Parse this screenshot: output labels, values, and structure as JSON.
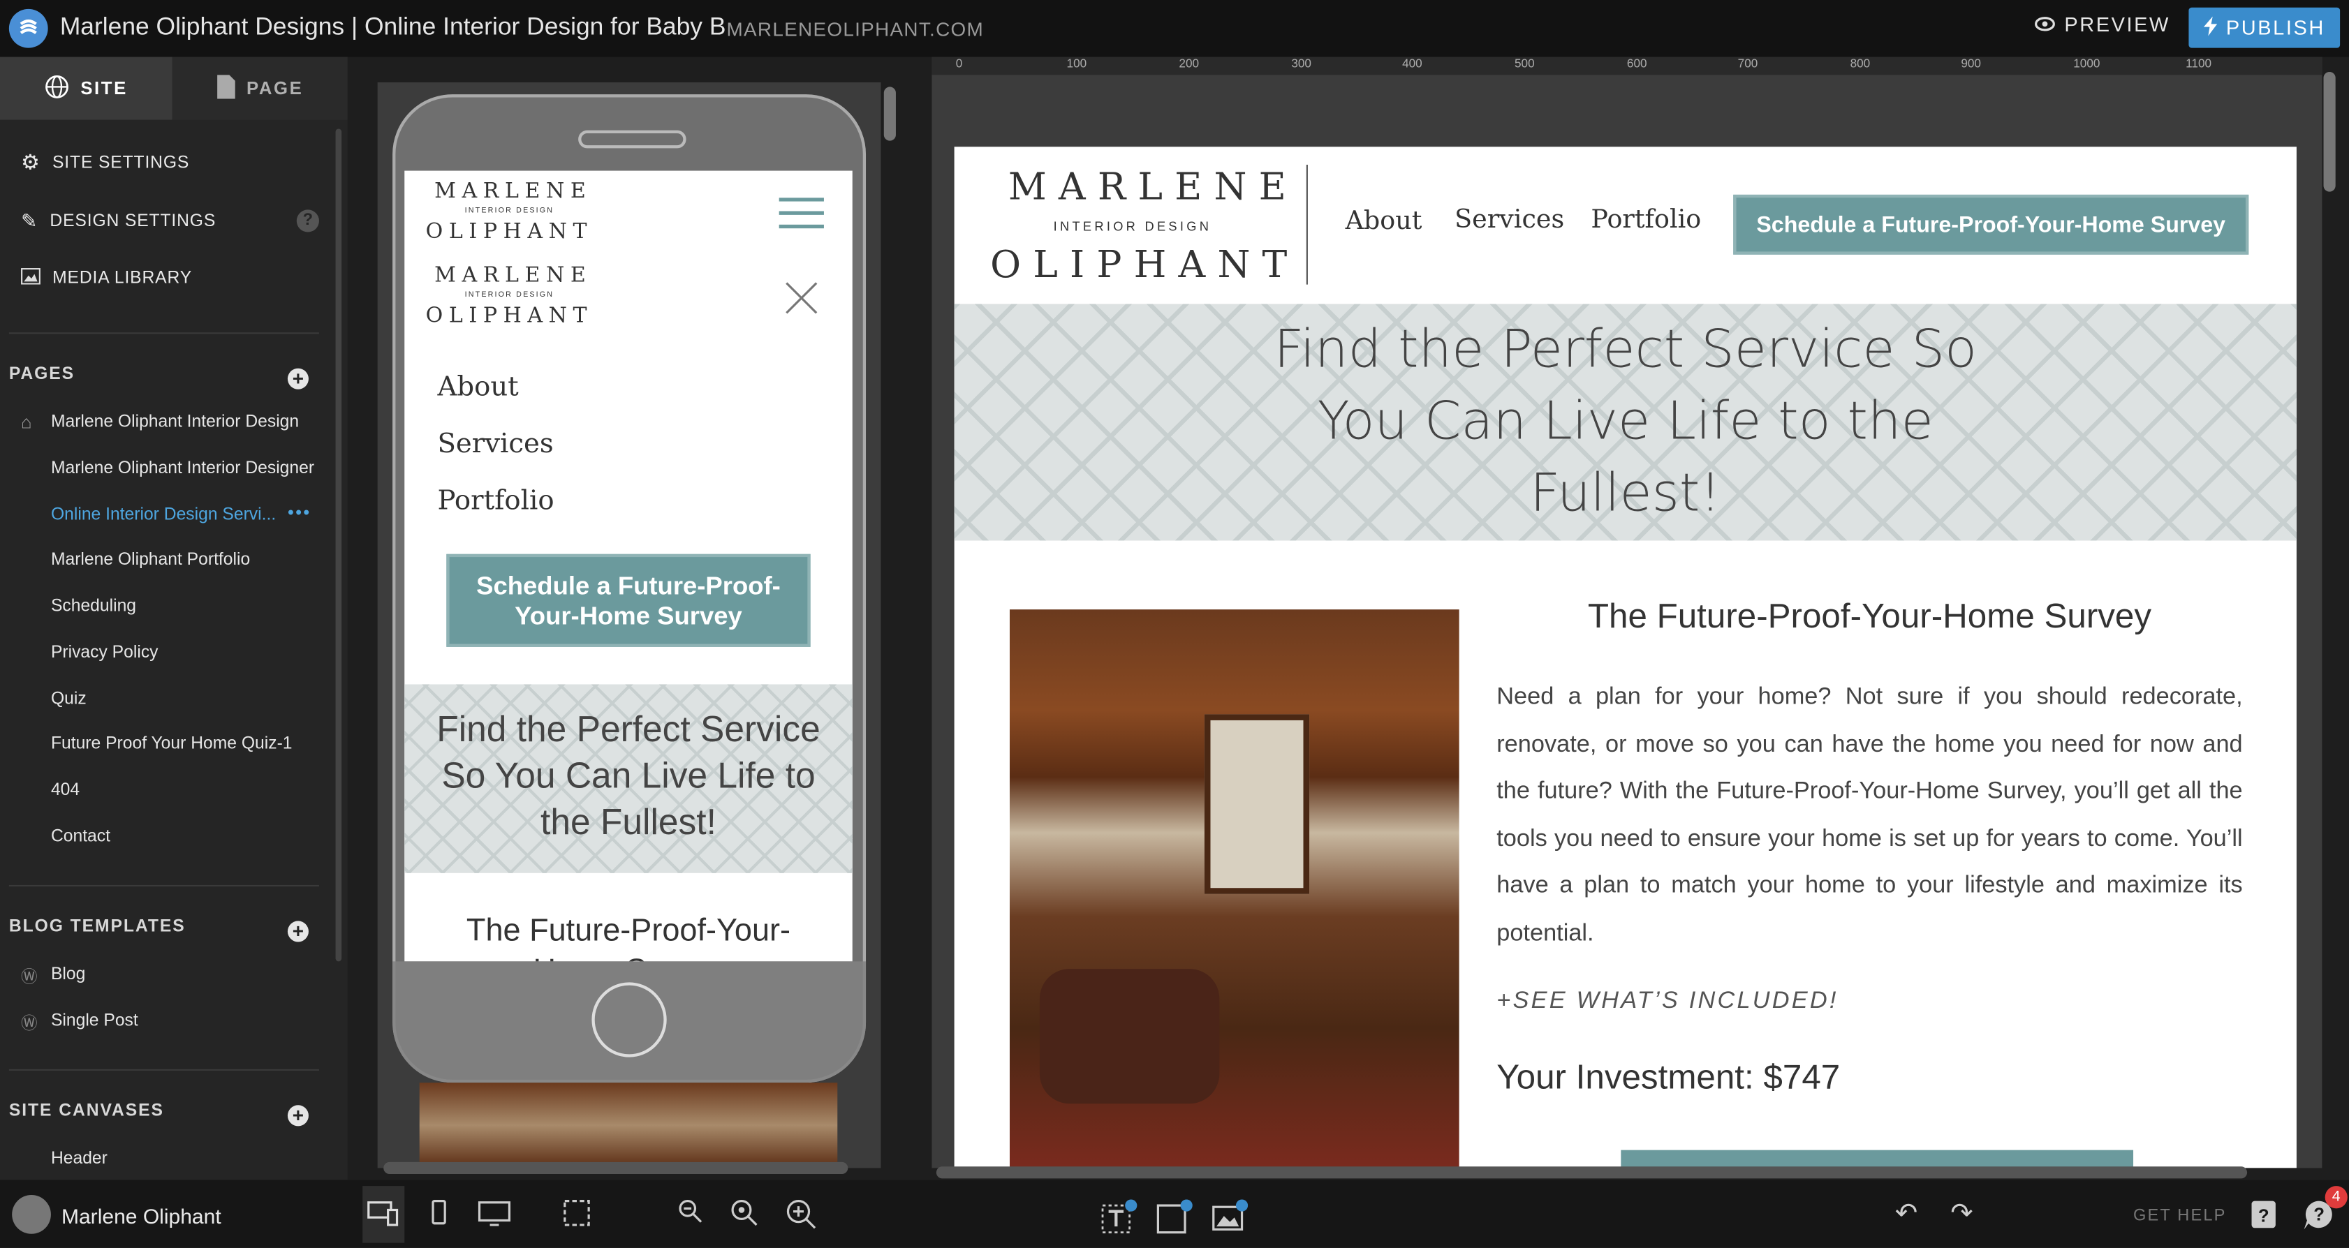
{
  "topbar": {
    "site_title": "Marlene Oliphant Designs | Online Interior Design for Baby B",
    "domain": "MARLENEOLIPHANT.COM",
    "preview_label": "PREVIEW",
    "publish_label": "PUBLISH"
  },
  "sidebar": {
    "site_tab": "SITE",
    "page_tab": "PAGE",
    "settings": [
      {
        "label": "SITE SETTINGS",
        "icon": "gear-icon"
      },
      {
        "label": "DESIGN SETTINGS",
        "icon": "brush-icon"
      },
      {
        "label": "MEDIA LIBRARY",
        "icon": "image-icon"
      }
    ],
    "pages_heading": "PAGES",
    "pages": [
      "Marlene Oliphant Interior Design",
      "Marlene Oliphant Interior Designer",
      "Online Interior Design Servi...",
      "Marlene Oliphant Portfolio",
      "Scheduling",
      "Privacy Policy",
      "Quiz",
      "Future Proof Your Home Quiz-1",
      "404",
      "Contact"
    ],
    "active_page_index": 2,
    "blog_heading": "BLOG TEMPLATES",
    "blog_templates": [
      "Blog",
      "Single Post"
    ],
    "canvases_heading": "SITE CANVASES",
    "canvases": [
      "Header"
    ]
  },
  "bottombar": {
    "user_name": "Marlene Oliphant",
    "help_label": "GET HELP",
    "notification_count": "4"
  },
  "ruler": {
    "ticks": [
      "0",
      "100",
      "200",
      "300",
      "400",
      "500",
      "600",
      "700",
      "800",
      "900",
      "1000",
      "1100"
    ]
  },
  "site": {
    "logo_line1": "MARLENE",
    "logo_sub": "INTERIOR DESIGN",
    "logo_line2": "OLIPHANT",
    "nav": [
      "About",
      "Services",
      "Portfolio"
    ],
    "cta": "Schedule a Future-Proof-Your-Home Survey",
    "banner_title": "Find the Perfect Service So You Can Live Life to the Fullest!",
    "survey_title": "The Future-Proof-Your-Home Survey",
    "body": "Need a plan for your home? Not sure if you should redecorate, renovate, or move so you can have the home you need for now and the future? With the Future-Proof-Your-Home Survey, you’ll get all the tools you need to ensure your home is set up for years to come. You’ll have a plan to match your home to your lifestyle and maximize its potential.",
    "included": "+SEE WHAT’S INCLUDED!",
    "investment": "Your Investment: $747"
  },
  "mobile": {
    "cta": "Schedule a Future-Proof-Your-Home Survey",
    "banner_title": "Find the Perfect Service So You Can Live Life to the Fullest!",
    "survey_title": "The Future-Proof-Your-Home Survey"
  },
  "colors": {
    "accent": "#3a8ccc",
    "brand_teal": "#6b9a9d",
    "active_page": "#4ea6e0"
  }
}
